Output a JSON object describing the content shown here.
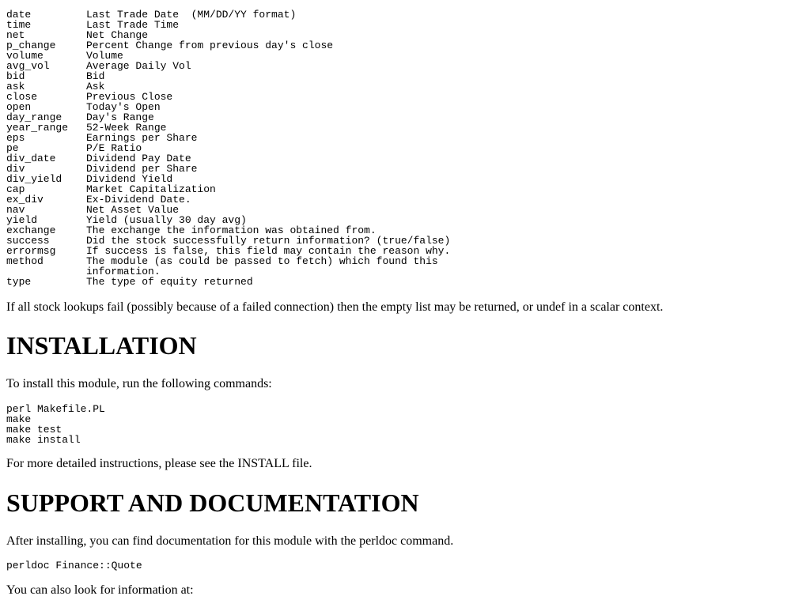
{
  "fields": [
    {
      "key": "date",
      "desc": "Last Trade Date  (MM/DD/YY format)"
    },
    {
      "key": "time",
      "desc": "Last Trade Time"
    },
    {
      "key": "net",
      "desc": "Net Change"
    },
    {
      "key": "p_change",
      "desc": "Percent Change from previous day's close"
    },
    {
      "key": "volume",
      "desc": "Volume"
    },
    {
      "key": "avg_vol",
      "desc": "Average Daily Vol"
    },
    {
      "key": "bid",
      "desc": "Bid"
    },
    {
      "key": "ask",
      "desc": "Ask"
    },
    {
      "key": "close",
      "desc": "Previous Close"
    },
    {
      "key": "open",
      "desc": "Today's Open"
    },
    {
      "key": "day_range",
      "desc": "Day's Range"
    },
    {
      "key": "year_range",
      "desc": "52-Week Range"
    },
    {
      "key": "eps",
      "desc": "Earnings per Share"
    },
    {
      "key": "pe",
      "desc": "P/E Ratio"
    },
    {
      "key": "div_date",
      "desc": "Dividend Pay Date"
    },
    {
      "key": "div",
      "desc": "Dividend per Share"
    },
    {
      "key": "div_yield",
      "desc": "Dividend Yield"
    },
    {
      "key": "cap",
      "desc": "Market Capitalization"
    },
    {
      "key": "ex_div",
      "desc": "Ex-Dividend Date."
    },
    {
      "key": "nav",
      "desc": "Net Asset Value"
    },
    {
      "key": "yield",
      "desc": "Yield (usually 30 day avg)"
    },
    {
      "key": "exchange",
      "desc": "The exchange the information was obtained from."
    },
    {
      "key": "success",
      "desc": "Did the stock successfully return information? (true/false)"
    },
    {
      "key": "errormsg",
      "desc": "If success is false, this field may contain the reason why."
    },
    {
      "key": "method",
      "desc": "The module (as could be passed to fetch) which found this\ninformation."
    },
    {
      "key": "type",
      "desc": "The type of equity returned"
    }
  ],
  "failure_note": "If all stock lookups fail (possibly because of a failed connection) then the empty list may be returned, or undef in a scalar context.",
  "installation": {
    "heading": "INSTALLATION",
    "intro": "To install this module, run the following commands:",
    "commands": "perl Makefile.PL\nmake\nmake test\nmake install",
    "more": "For more detailed instructions, please see the INSTALL file."
  },
  "support": {
    "heading": "SUPPORT AND DOCUMENTATION",
    "intro": "After installing, you can find documentation for this module with the perldoc command.",
    "command": "perldoc Finance::Quote",
    "more": "You can also look for information at:"
  }
}
